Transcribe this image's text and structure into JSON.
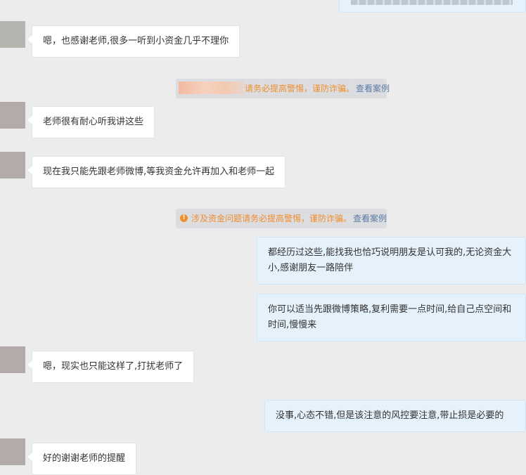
{
  "messages": [
    {
      "text": "嗯，也感谢老师,很多一听到小资金几乎不理你"
    },
    {
      "text": "老师很有耐心听我讲这些"
    },
    {
      "text": "现在我只能先跟老师微博,等我资金允许再加入和老师一起"
    },
    {
      "text": "都经历过这些,能找我也恰巧说明朋友是认可我的,无论资金大小,感谢朋友一路陪伴"
    },
    {
      "text": "你可以适当先跟微博策略,复利需要一点时间,给自己点空间和时间,慢慢来"
    },
    {
      "text": "嗯，现实也只能这样了,打扰老师了"
    },
    {
      "text": "没事,心态不错,但是该注意的风控要注意,带止损是必要的"
    },
    {
      "text": "好的谢谢老师的提醒"
    }
  ],
  "notices": [
    {
      "text": "请务必提高警惕，谨防诈骗。",
      "link": "查看案例"
    },
    {
      "text": "涉及资金问题请务必提高警惕，谨防诈骗。",
      "link": "查看案例",
      "icon": "warning-icon"
    }
  ],
  "colors": {
    "background": "#ececec",
    "incoming_bubble": "#ffffff",
    "outgoing_bubble": "#e5f1fb",
    "notice_text": "#f08d2c",
    "notice_link": "#5b7ba3"
  }
}
